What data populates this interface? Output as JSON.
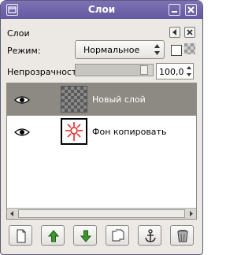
{
  "window": {
    "title": "Слои"
  },
  "panel": {
    "title": "Слои"
  },
  "mode": {
    "label": "Режим:",
    "value": "Нормальное"
  },
  "opacity": {
    "label": "Непрозрачность:",
    "value": "100,0",
    "level_fraction": 1.0
  },
  "layers": [
    {
      "name": "Новый слой",
      "visible": true,
      "selected": true,
      "thumbnail": "transparent-checker"
    },
    {
      "name": "Фон копировать",
      "visible": true,
      "selected": false,
      "thumbnail": "red-sun-drawing"
    }
  ],
  "toolbar": {
    "buttons": [
      {
        "icon": "new-layer-icon"
      },
      {
        "icon": "raise-layer-icon"
      },
      {
        "icon": "lower-layer-icon"
      },
      {
        "icon": "duplicate-layer-icon"
      },
      {
        "icon": "anchor-layer-icon"
      },
      {
        "icon": "delete-layer-icon"
      }
    ]
  },
  "colors": {
    "titlebar": "#6c62a8",
    "selected_row": "#8c8a82",
    "arrow_green": "#3c9a2c",
    "sun_red": "#e01818"
  }
}
